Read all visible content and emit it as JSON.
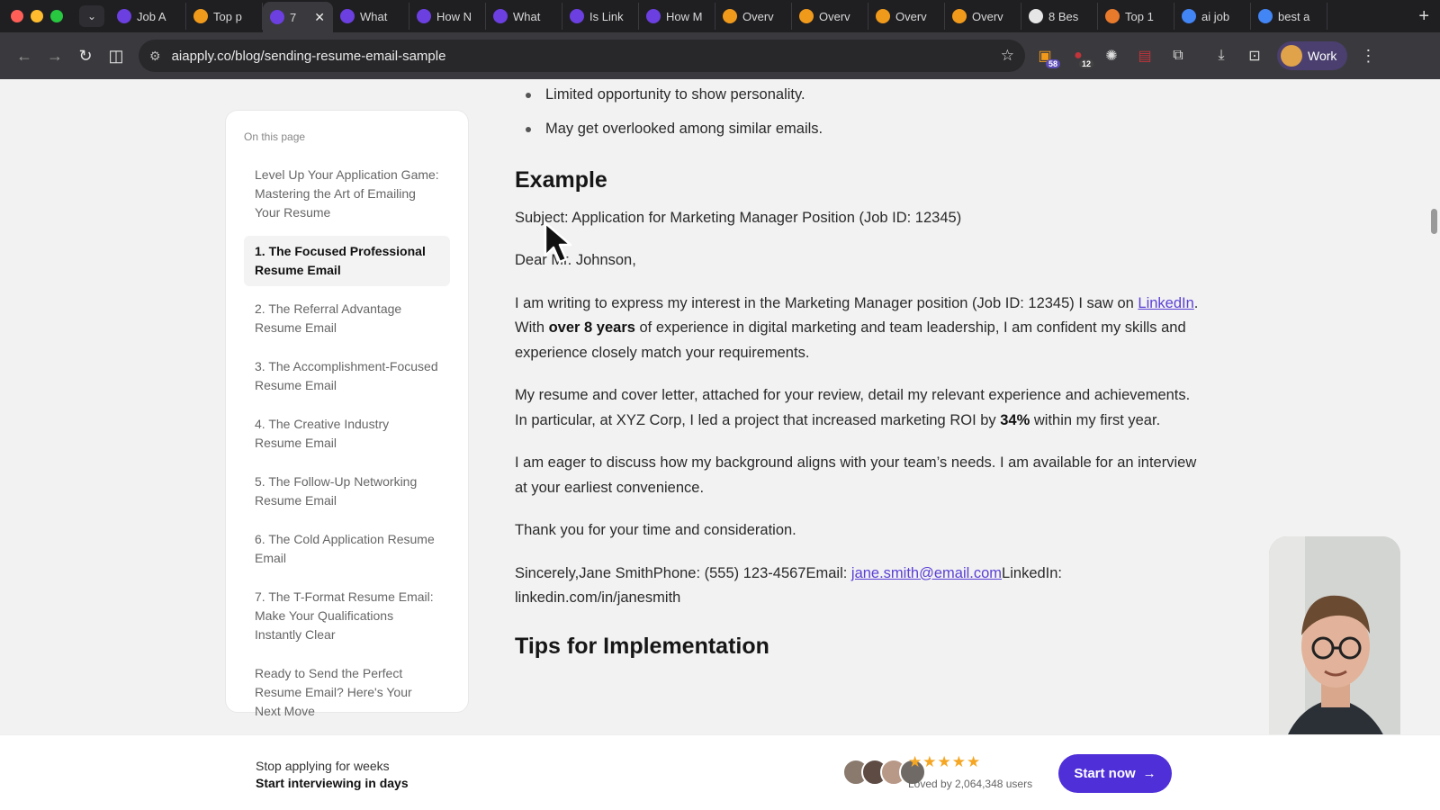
{
  "browser": {
    "tabs": [
      {
        "icon": "aiapply-icon",
        "title": "Job A",
        "color": "#6b3fe0"
      },
      {
        "icon": "amazon-icon",
        "title": "Top p",
        "color": "#f09a1c"
      },
      {
        "icon": "aiapply-icon",
        "title": "7",
        "color": "#6b3fe0",
        "active": true
      },
      {
        "icon": "aiapply-icon",
        "title": "What",
        "color": "#6b3fe0"
      },
      {
        "icon": "aiapply-icon",
        "title": "How N",
        "color": "#6b3fe0"
      },
      {
        "icon": "aiapply-icon",
        "title": "What",
        "color": "#6b3fe0"
      },
      {
        "icon": "aiapply-icon",
        "title": "Is Link",
        "color": "#6b3fe0"
      },
      {
        "icon": "aiapply-icon",
        "title": "How M",
        "color": "#6b3fe0"
      },
      {
        "icon": "amazon-icon",
        "title": "Overv",
        "color": "#f09a1c"
      },
      {
        "icon": "amazon-icon",
        "title": "Overv",
        "color": "#f09a1c"
      },
      {
        "icon": "amazon-icon",
        "title": "Overv",
        "color": "#f09a1c"
      },
      {
        "icon": "amazon-icon",
        "title": "Overv",
        "color": "#f09a1c"
      },
      {
        "icon": "github-icon",
        "title": "8 Bes",
        "color": "#e6e6e6"
      },
      {
        "icon": "medium-icon",
        "title": "Top 1",
        "color": "#e87a2c"
      },
      {
        "icon": "google-icon",
        "title": "ai job",
        "color": "#4285f4"
      },
      {
        "icon": "google-icon",
        "title": "best a",
        "color": "#4285f4"
      }
    ],
    "url": "aiapply.co/blog/sending-resume-email-sample",
    "extension_badges": {
      "first": "58",
      "second": "12"
    },
    "profile_label": "Work"
  },
  "toc": {
    "heading": "On this page",
    "items": [
      "Level Up Your Application Game: Mastering the Art of Emailing Your Resume",
      "1. The Focused Professional Resume Email",
      "2. The Referral Advantage Resume Email",
      "3. The Accomplishment-Focused Resume Email",
      "4. The Creative Industry Resume Email",
      "5. The Follow-Up Networking Resume Email",
      "6. The Cold Application Resume Email",
      "7. The T-Format Resume Email: Make Your Qualifications Instantly Clear",
      "Ready to Send the Perfect Resume Email? Here's Your Next Move"
    ],
    "active_index": 1
  },
  "article": {
    "bullets": [
      "Limited opportunity to show personality.",
      "May get overlooked among similar emails."
    ],
    "example_heading": "Example",
    "subject": "Subject: Application for Marketing Manager Position (Job ID: 12345)",
    "greeting": "Dear Mr. Johnson,",
    "p1_a": "I am writing to express my interest in the Marketing Manager position (Job ID: 12345) I saw on ",
    "p1_link": "LinkedIn",
    "p1_b": ". With ",
    "p1_bold": "over 8 years",
    "p1_c": " of experience in digital marketing and team leadership, I am confident my skills and experience closely match your requirements.",
    "p2_a": "My resume and cover letter, attached for your review, detail my relevant experience and achievements. In particular, at XYZ Corp, I led a project that increased marketing ROI by ",
    "p2_bold": "34%",
    "p2_b": " within my first year.",
    "p3": "I am eager to discuss how my background aligns with your team’s needs. I am available for an interview at your earliest convenience.",
    "p4": "Thank you for your time and consideration.",
    "sig_a": "Sincerely,Jane SmithPhone: (555) 123-4567Email: ",
    "sig_email": "jane.smith@email.com",
    "sig_b": "LinkedIn: linkedin.com/in/janesmith",
    "tips_heading": "Tips for Implementation"
  },
  "banner": {
    "line1": "Stop applying for weeks",
    "line2": "Start interviewing in days",
    "stars": "★★★★★",
    "loved": "Loved by 2,064,348 users",
    "cta": "Start now",
    "cta_arrow": "→"
  },
  "colors": {
    "accent": "#4f2fd8",
    "link": "#5b3fd6",
    "star": "#f5a623"
  }
}
